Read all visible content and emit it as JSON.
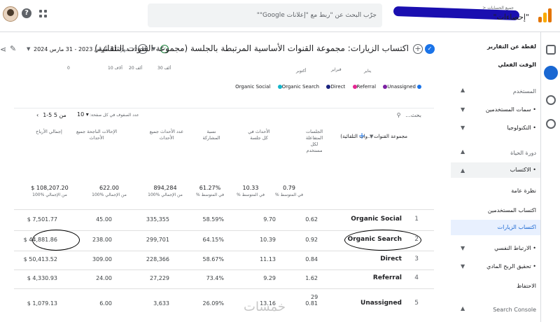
{
  "topbar": {
    "search_placeholder": "جرّب البحث عن \"ربط مع \"إعلانات Google\"\"",
    "account_crumb": "جميع الحسابات <",
    "property_label": "\"إحصاءات\"",
    "help_label": "?"
  },
  "sidebar": {
    "items": [
      {
        "label": "لقطة عن التقارير",
        "type": "header"
      },
      {
        "label": "الوقت الفعلي",
        "type": "item"
      },
      {
        "label": "المستخدم",
        "type": "section"
      },
      {
        "label": "• سمات المستخدمين",
        "type": "item"
      },
      {
        "label": "• التكنولوجيا",
        "type": "item"
      },
      {
        "label": "دورة الحياة",
        "type": "section"
      },
      {
        "label": "• الاكتساب",
        "type": "item"
      },
      {
        "label": "نظرة عامة",
        "type": "item"
      },
      {
        "label": "اكتساب المستخدمين",
        "type": "item"
      },
      {
        "label": "اكتساب الزيارات",
        "type": "item"
      },
      {
        "label": "• الارتباط النفسي",
        "type": "item"
      },
      {
        "label": "• تحقيق الربح المادي",
        "type": "item"
      },
      {
        "label": "الاحتفاظ",
        "type": "item"
      },
      {
        "label": "Search Console",
        "type": "section"
      }
    ]
  },
  "header": {
    "title": "اكتساب الزيارات: مجموعة القنوات الأساسية المرتبطة بالجلسة (مجموعة القنوات التلقائية)",
    "date_prefix": "آخر 12 شهرًا",
    "date_range": "31 مارس 2023 - 31 مارس 2024",
    "add_label": "+"
  },
  "chart_axis": {
    "ticks": [
      "0",
      "10 آلاف",
      "20 ألف",
      "30 ألف"
    ],
    "month_labels": [
      "يناير",
      "فبراير",
      "أكتوبر"
    ]
  },
  "legend": {
    "items": [
      {
        "label": "Organic Social",
        "color": "#1a73e8"
      },
      {
        "label": "Organic Search",
        "color": "#12b5cb"
      },
      {
        "label": "Direct",
        "color": "#1a237e"
      },
      {
        "label": "Referral",
        "color": "#e52592"
      },
      {
        "label": "Unassigned",
        "color": "#7b1fa2"
      }
    ]
  },
  "controls": {
    "search_placeholder": "بحث...",
    "rows_label": "عدد الصفوف في كل صفحة:",
    "rows_value": "10",
    "pager": "1-5 من 5"
  },
  "table": {
    "dimension_header": "مجموعة القنوات ...وات التلقائية)",
    "columns": [
      {
        "label": "الجلسات المتفاعلة لكل مستخدم"
      },
      {
        "label": "الأحداث في كل جلسة"
      },
      {
        "label": "نسبة المشاركة"
      },
      {
        "label": "عدد الأحداث جميع الأحداث"
      },
      {
        "label": "الإحالات الناجحة جميع الأحداث"
      },
      {
        "label": "إجمالي الأرباح"
      }
    ],
    "totals": [
      "0.79",
      "10.33",
      "61.27%",
      "894,284",
      "622.00",
      "$ 108,207.20"
    ],
    "totals_sub": [
      "% في المتوسط",
      "% في المتوسط",
      "% في المتوسط",
      "100% من الإجمالي",
      "100% من الإجمالي",
      "100% من الإجمالي"
    ],
    "rows": [
      {
        "idx": "1",
        "channel": "Organic Social",
        "values": [
          "0.62",
          "9.70",
          "58.59%",
          "335,355",
          "45.00",
          "$ 7,501.77"
        ]
      },
      {
        "idx": "2",
        "channel": "Organic Search",
        "values": [
          "0.92",
          "10.39",
          "64.15%",
          "299,701",
          "238.00",
          "$ 44,881.86"
        ]
      },
      {
        "idx": "3",
        "channel": "Direct",
        "values": [
          "0.84",
          "11.13",
          "58.67%",
          "228,366",
          "309.00",
          "$ 50,413.52"
        ]
      },
      {
        "idx": "4",
        "channel": "Referral",
        "values": [
          "1.62",
          "9.29",
          "73.4%",
          "27,229",
          "24.00",
          "$ 4,330.93"
        ]
      },
      {
        "idx": "5",
        "channel": "Unassigned",
        "values": [
          "0.81",
          "13.16",
          "26.09%",
          "3,633",
          "6.00",
          "$ 1,079.13"
        ]
      }
    ],
    "side_number": "29"
  },
  "watermark": "خمسات"
}
